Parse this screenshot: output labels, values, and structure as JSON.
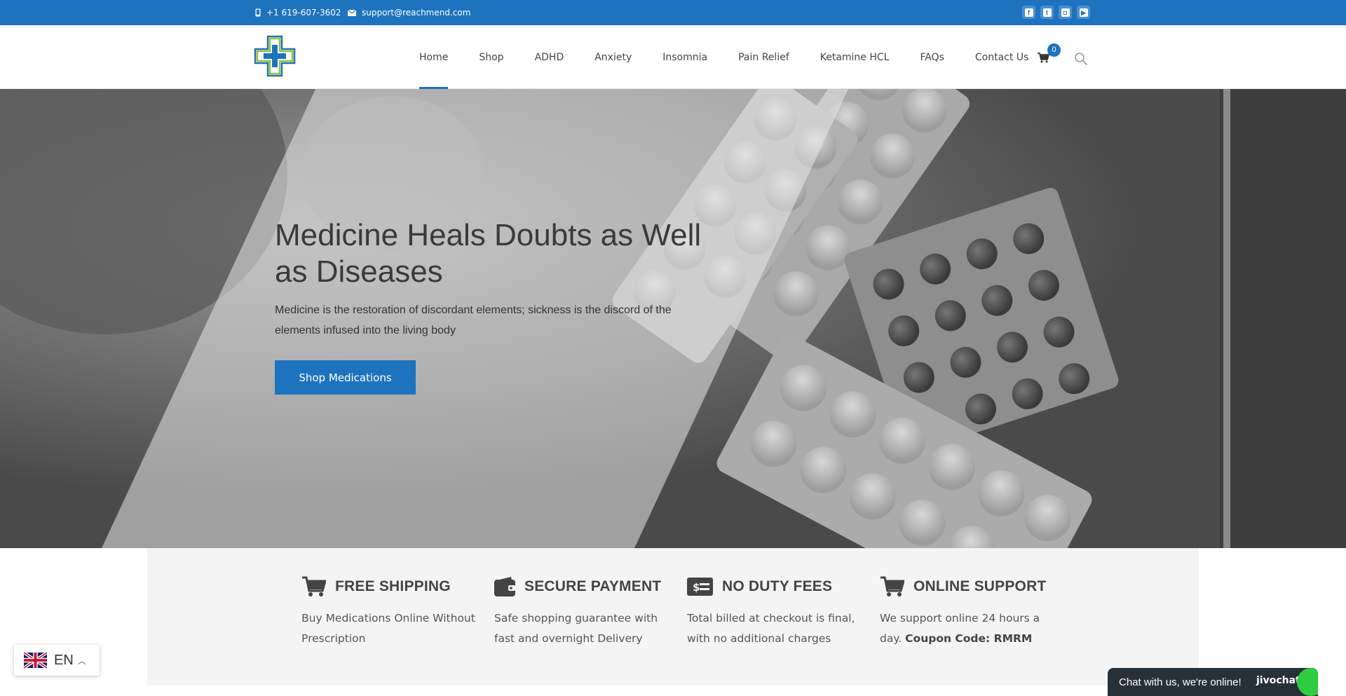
{
  "topbar": {
    "phone": "+1 619-607-3602",
    "email": "support@reachmend.com",
    "social": [
      "facebook-icon",
      "twitter-icon",
      "instagram-icon",
      "youtube-icon"
    ]
  },
  "nav": {
    "items": [
      "Home",
      "Shop",
      "ADHD",
      "Anxiety",
      "Insomnia",
      "Pain Relief",
      "Ketamine HCL",
      "FAQs",
      "Contact Us"
    ],
    "active": "Home",
    "cart_count": "0"
  },
  "hero": {
    "title": "Medicine Heals Doubts as Well as Diseases",
    "subtitle": "Medicine is the restoration of discordant elements; sickness is the discord of the elements infused into the living body",
    "button": "Shop Medications"
  },
  "features": [
    {
      "icon": "cart-icon",
      "title": "FREE SHIPPING",
      "desc": "Buy Medications Online Without Prescription",
      "desc_bold": ""
    },
    {
      "icon": "wallet-icon",
      "title": "SECURE PAYMENT",
      "desc": "Safe shopping guarantee with fast and overnight Delivery",
      "desc_bold": ""
    },
    {
      "icon": "money-icon",
      "title": "NO DUTY FEES",
      "desc": "Total billed at checkout is final, with no additional charges",
      "desc_bold": ""
    },
    {
      "icon": "cart-icon",
      "title": "ONLINE SUPPORT",
      "desc": "We support online 24 hours a day.",
      "desc_bold": "Coupon Code: RMRM"
    }
  ],
  "language": {
    "code": "EN"
  },
  "chat": {
    "text": "Chat with us, we're online!",
    "brand": "jivochat"
  },
  "colors": {
    "accent": "#1e73be",
    "feature_bg": "#f4f4f4",
    "chat_bg": "#263238"
  }
}
